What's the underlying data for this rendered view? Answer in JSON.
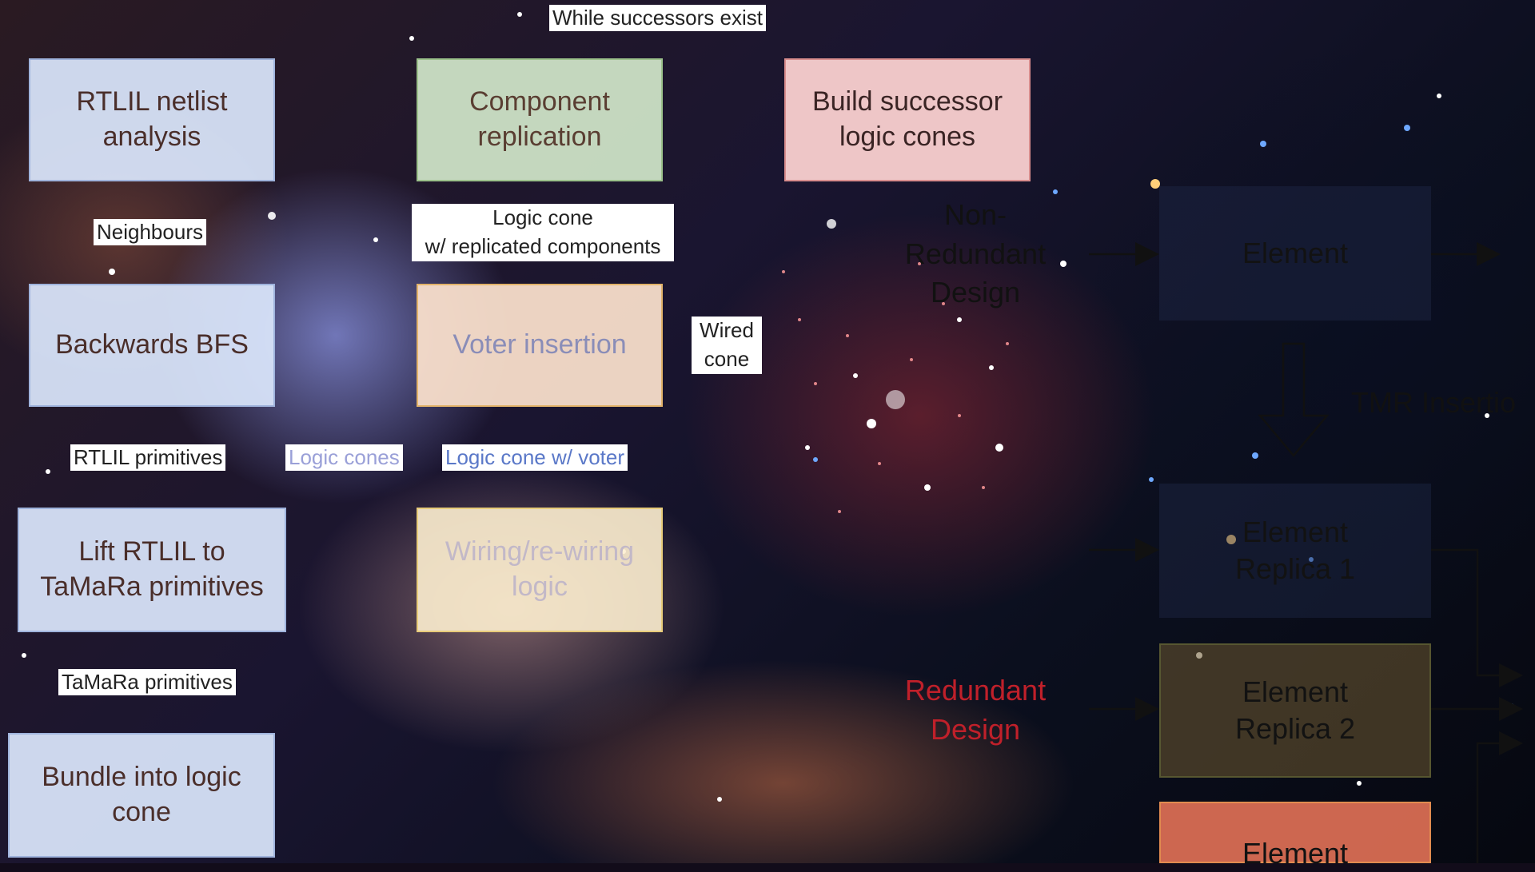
{
  "boxes": {
    "rtlil_analysis": "RTLIL netlist\nanalysis",
    "component_replication": "Component\nreplication",
    "build_successor": "Build successor\nlogic cones",
    "backwards_bfs": "Backwards BFS",
    "voter_insertion": "Voter insertion",
    "lift_rtlil": "Lift RTLIL to\nTaMaRa primitives",
    "wiring": "Wiring/re-wiring\nlogic",
    "bundle": "Bundle into logic\ncone"
  },
  "labels": {
    "while_successors": "While successors exist",
    "neighbours": "Neighbours",
    "logic_cone_replicated": "Logic cone\nw/ replicated components",
    "wired_cone": "Wired\ncone",
    "rtlil_primitives": "RTLIL primitives",
    "logic_cones": "Logic cones",
    "logic_cone_voter": "Logic cone w/ voter",
    "tamara_primitives": "TaMaRa primitives"
  },
  "tmr_diagram": {
    "non_redundant": "Non-\nRedundant\nDesign",
    "redundant": "Redundant\nDesign",
    "tmr_insertion": "TMR Insertio",
    "element": "Element",
    "replica1": "Element\nReplica 1",
    "replica2": "Element\nReplica 2",
    "element_bottom": "Element"
  },
  "colors": {
    "blue_box": "#dae6fc",
    "green_box": "#d6ecce",
    "red_box": "#fad0d0",
    "orange_box": "#fce2ce",
    "yellow_box": "#fef0d0",
    "redundant_text": "#c0202a"
  }
}
